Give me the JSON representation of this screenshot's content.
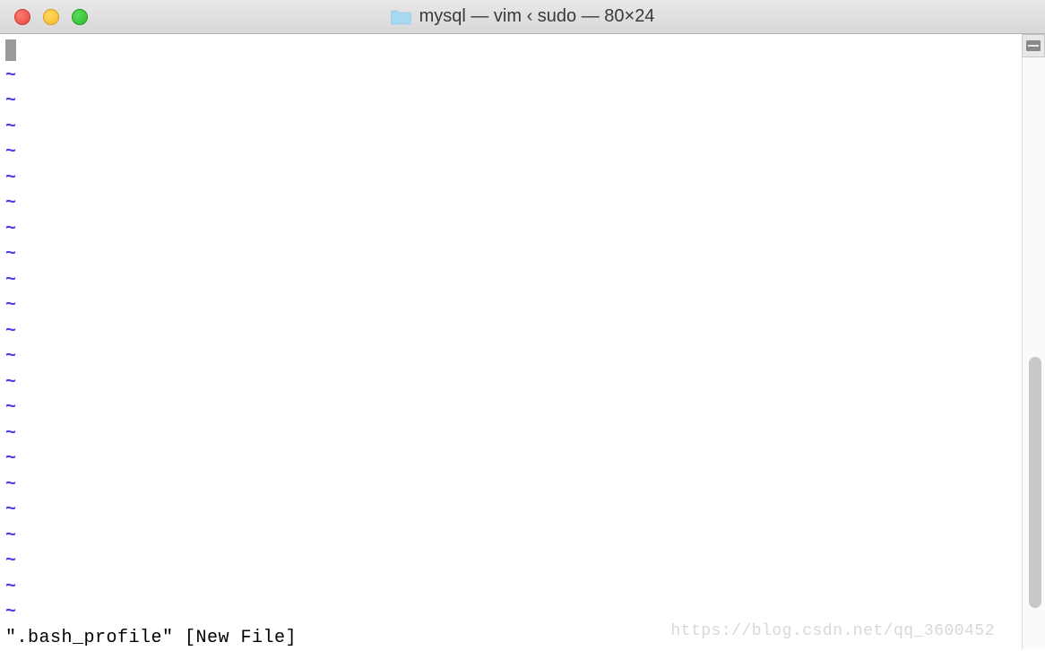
{
  "window": {
    "title": "mysql — vim ‹ sudo — 80×24"
  },
  "editor": {
    "empty_line_marker": "~",
    "tilde_count": 22,
    "status_line": "\".bash_profile\" [New File]"
  },
  "watermark": "https://blog.csdn.net/qq_3600452"
}
